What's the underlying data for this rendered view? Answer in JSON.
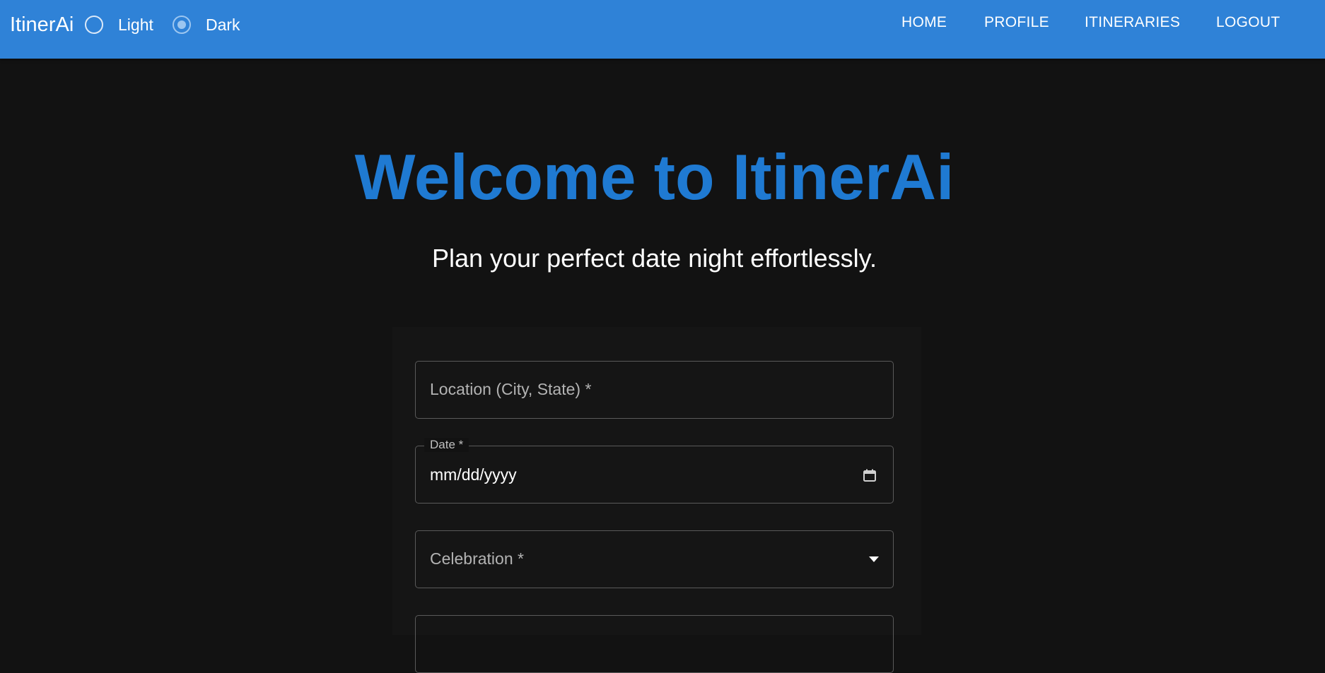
{
  "app": {
    "brand": "ItinerAi",
    "theme_options": [
      {
        "label": "Light",
        "selected": false
      },
      {
        "label": "Dark",
        "selected": true
      }
    ],
    "nav": [
      "HOME",
      "PROFILE",
      "ITINERARIES",
      "LOGOUT"
    ]
  },
  "hero": {
    "title": "Welcome to ItinerAi",
    "subtitle": "Plan your perfect date night effortlessly."
  },
  "form": {
    "location_label": "Location (City, State) *",
    "date_label": "Date *",
    "date_placeholder": "mm/dd/yyyy",
    "celebration_label": "Celebration *"
  },
  "colors": {
    "appbar": "#2f82d7",
    "background": "#121212",
    "accent": "#1f7ad2"
  },
  "icons": {
    "date": "calendar-icon",
    "select": "dropdown-arrow-icon"
  }
}
